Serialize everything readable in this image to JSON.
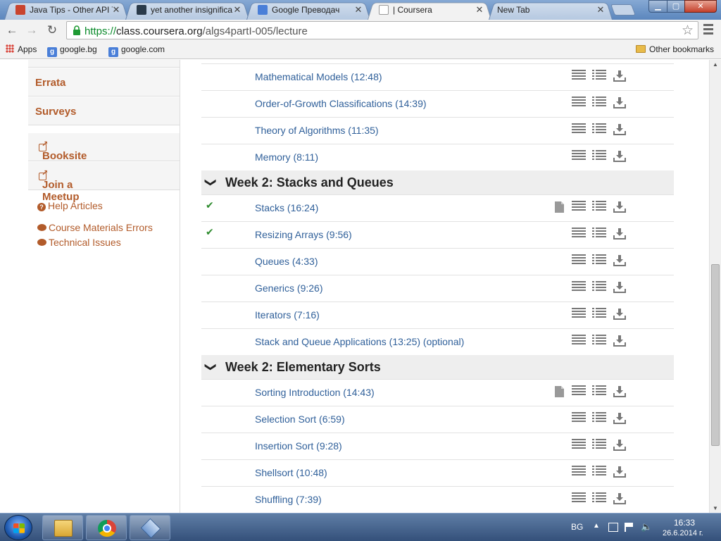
{
  "tabs": [
    {
      "title": "Java Tips - Other API T",
      "favicon_color": "#c9442e"
    },
    {
      "title": "yet another insignifica",
      "favicon_color": "#2a3a4a"
    },
    {
      "title": "Google Преводач",
      "favicon_color": "#4a7fd8"
    },
    {
      "title": "| Coursera",
      "favicon_color": "#ffffff",
      "active": true
    },
    {
      "title": "New Tab",
      "favicon_color": ""
    }
  ],
  "address_bar": {
    "scheme": "https://",
    "host": "class.coursera.org",
    "path": "/algs4partI-005/lecture"
  },
  "bookmarks": {
    "apps": "Apps",
    "items": [
      "google.bg",
      "google.com"
    ],
    "other": "Other bookmarks"
  },
  "sidebar": {
    "items": [
      "Errata",
      "Surveys",
      "Booksite",
      "Join a Meetup"
    ],
    "help": "Help Articles",
    "links": [
      "Course Materials Errors",
      "Technical Issues"
    ]
  },
  "lectures": {
    "prev_items": [
      {
        "title": "Mathematical Models (12:48)"
      },
      {
        "title": "Order-of-Growth Classifications (14:39)"
      },
      {
        "title": "Theory of Algorithms (11:35)"
      },
      {
        "title": "Memory (8:11)"
      }
    ],
    "weeks": [
      {
        "title": "Week 2: Stacks and Queues",
        "items": [
          {
            "title": "Stacks (16:24)",
            "watched": true,
            "has_slides": true
          },
          {
            "title": "Resizing Arrays (9:56)",
            "watched": true,
            "has_slides": false
          },
          {
            "title": "Queues (4:33)",
            "watched": false,
            "has_slides": false
          },
          {
            "title": "Generics (9:26)",
            "watched": false,
            "has_slides": false
          },
          {
            "title": "Iterators (7:16)",
            "watched": false,
            "has_slides": false
          },
          {
            "title": "Stack and Queue Applications (13:25) (optional)",
            "watched": false,
            "has_slides": false
          }
        ]
      },
      {
        "title": "Week 2: Elementary Sorts",
        "items": [
          {
            "title": "Sorting Introduction (14:43)",
            "watched": false,
            "has_slides": true
          },
          {
            "title": "Selection Sort (6:59)",
            "watched": false,
            "has_slides": false
          },
          {
            "title": "Insertion Sort (9:28)",
            "watched": false,
            "has_slides": false
          },
          {
            "title": "Shellsort (10:48)",
            "watched": false,
            "has_slides": false
          },
          {
            "title": "Shuffling (7:39)",
            "watched": false,
            "has_slides": false
          }
        ]
      }
    ]
  },
  "taskbar": {
    "lang": "BG",
    "time": "16:33",
    "date": "26.6.2014 г."
  },
  "colors": {
    "link": "#30609a",
    "sidebar_link": "#b25b2a",
    "check": "#2e8b2e"
  }
}
